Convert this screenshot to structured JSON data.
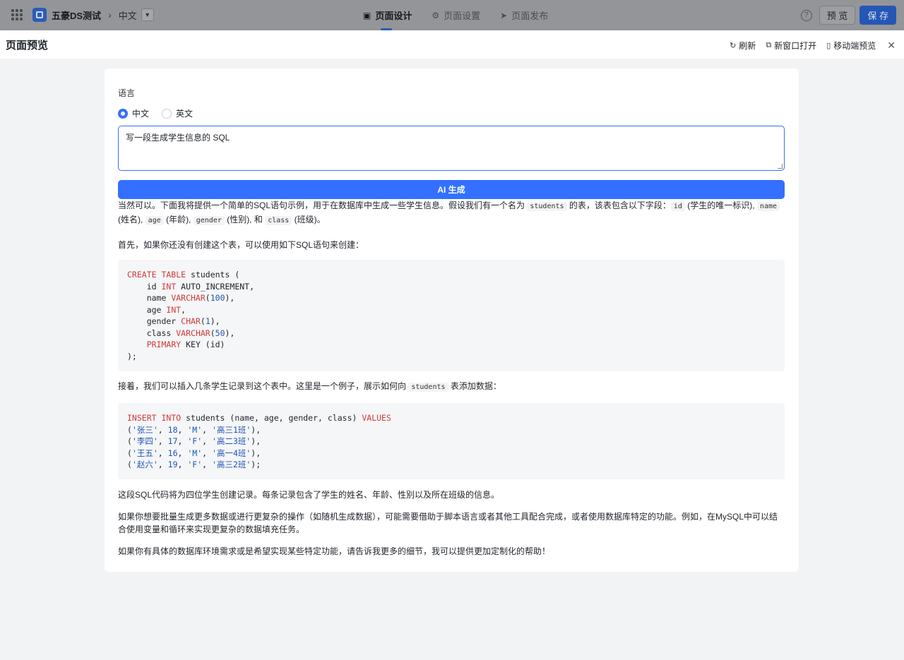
{
  "topbar": {
    "app_name": "五豪DS测试",
    "breadcrumb_sep": "›",
    "language": "中文",
    "tabs": [
      {
        "label": "页面设计",
        "icon": "layout-icon"
      },
      {
        "label": "页面设置",
        "icon": "gear-icon"
      },
      {
        "label": "页面发布",
        "icon": "send-icon"
      }
    ],
    "preview_label": "预 览",
    "save_label": "保 存"
  },
  "modal": {
    "title": "页面预览",
    "actions": [
      {
        "label": "刷新",
        "icon": "refresh-icon"
      },
      {
        "label": "新窗口打开",
        "icon": "new-window-icon"
      },
      {
        "label": "移动端预览",
        "icon": "mobile-icon"
      }
    ]
  },
  "form": {
    "language_label": "语言",
    "options": [
      {
        "label": "中文",
        "selected": true
      },
      {
        "label": "英文",
        "selected": false
      }
    ],
    "prompt_value": "写一段生成学生信息的 SQL",
    "generate_label": "AI 生成"
  },
  "answer": {
    "p1_a": "当然可以。下面我将提供一个简单的SQL语句示例，用于在数据库中生成一些学生信息。假设我们有一个名为 ",
    "p1_code1": "students",
    "p1_b": " 的表，该表包含以下字段：",
    "p1_code2": "id",
    "p1_c": " (学生的唯一标识), ",
    "p1_code3": "name",
    "p1_d": " (姓名), ",
    "p1_code4": "age",
    "p1_e": " (年龄), ",
    "p1_code5": "gender",
    "p1_f": " (性别), 和 ",
    "p1_code6": "class",
    "p1_g": " (班级)。",
    "p2": "首先，如果你还没有创建这个表，可以使用如下SQL语句来创建：",
    "p3_a": "接着，我们可以插入几条学生记录到这个表中。这里是一个例子，展示如何向 ",
    "p3_code": "students",
    "p3_b": " 表添加数据：",
    "p4": "这段SQL代码将为四位学生创建记录。每条记录包含了学生的姓名、年龄、性别以及所在班级的信息。",
    "p5": "如果你想要批量生成更多数据或进行更复杂的操作（如随机生成数据），可能需要借助于脚本语言或者其他工具配合完成，或者使用数据库特定的功能。例如，在MySQL中可以结合使用变量和循环来实现更复杂的数据填充任务。",
    "p6": "如果你有具体的数据库环境需求或是希望实现某些特定功能，请告诉我更多的细节，我可以提供更加定制化的帮助！",
    "create_sql": [
      [
        [
          "kw",
          "CREATE TABLE"
        ],
        [
          "t",
          " students ("
        ]
      ],
      [
        [
          "t",
          "    id "
        ],
        [
          "kw",
          "INT"
        ],
        [
          "t",
          " AUTO_INCREMENT,"
        ]
      ],
      [
        [
          "t",
          "    name "
        ],
        [
          "kw",
          "VARCHAR"
        ],
        [
          "t",
          "("
        ],
        [
          "num",
          "100"
        ],
        [
          "t",
          "),"
        ]
      ],
      [
        [
          "t",
          "    age "
        ],
        [
          "kw",
          "INT"
        ],
        [
          "t",
          ","
        ]
      ],
      [
        [
          "t",
          "    gender "
        ],
        [
          "kw",
          "CHAR"
        ],
        [
          "t",
          "("
        ],
        [
          "num",
          "1"
        ],
        [
          "t",
          "),"
        ]
      ],
      [
        [
          "t",
          "    class "
        ],
        [
          "kw",
          "VARCHAR"
        ],
        [
          "t",
          "("
        ],
        [
          "num",
          "50"
        ],
        [
          "t",
          "),"
        ]
      ],
      [
        [
          "t",
          "    "
        ],
        [
          "kw",
          "PRIMARY"
        ],
        [
          "t",
          " KEY (id)"
        ]
      ],
      [
        [
          "t",
          ");"
        ]
      ]
    ],
    "insert_sql": [
      [
        [
          "kw",
          "INSERT INTO"
        ],
        [
          "t",
          " students (name, age, gender, class) "
        ],
        [
          "kw",
          "VALUES"
        ]
      ],
      [
        [
          "t",
          "("
        ],
        [
          "str",
          "'张三'"
        ],
        [
          "t",
          ", "
        ],
        [
          "num",
          "18"
        ],
        [
          "t",
          ", "
        ],
        [
          "str",
          "'M'"
        ],
        [
          "t",
          ", "
        ],
        [
          "str",
          "'高三1班'"
        ],
        [
          "t",
          "),"
        ]
      ],
      [
        [
          "t",
          "("
        ],
        [
          "str",
          "'李四'"
        ],
        [
          "t",
          ", "
        ],
        [
          "num",
          "17"
        ],
        [
          "t",
          ", "
        ],
        [
          "str",
          "'F'"
        ],
        [
          "t",
          ", "
        ],
        [
          "str",
          "'高二3班'"
        ],
        [
          "t",
          "),"
        ]
      ],
      [
        [
          "t",
          "("
        ],
        [
          "str",
          "'王五'"
        ],
        [
          "t",
          ", "
        ],
        [
          "num",
          "16"
        ],
        [
          "t",
          ", "
        ],
        [
          "str",
          "'M'"
        ],
        [
          "t",
          ", "
        ],
        [
          "str",
          "'高一4班'"
        ],
        [
          "t",
          "),"
        ]
      ],
      [
        [
          "t",
          "("
        ],
        [
          "str",
          "'赵六'"
        ],
        [
          "t",
          ", "
        ],
        [
          "num",
          "19"
        ],
        [
          "t",
          ", "
        ],
        [
          "str",
          "'F'"
        ],
        [
          "t",
          ", "
        ],
        [
          "str",
          "'高三2班'"
        ],
        [
          "t",
          ");"
        ]
      ]
    ]
  },
  "colors": {
    "accent": "#3370ff",
    "keyword": "#d03a3a",
    "number": "#1f55b5"
  }
}
